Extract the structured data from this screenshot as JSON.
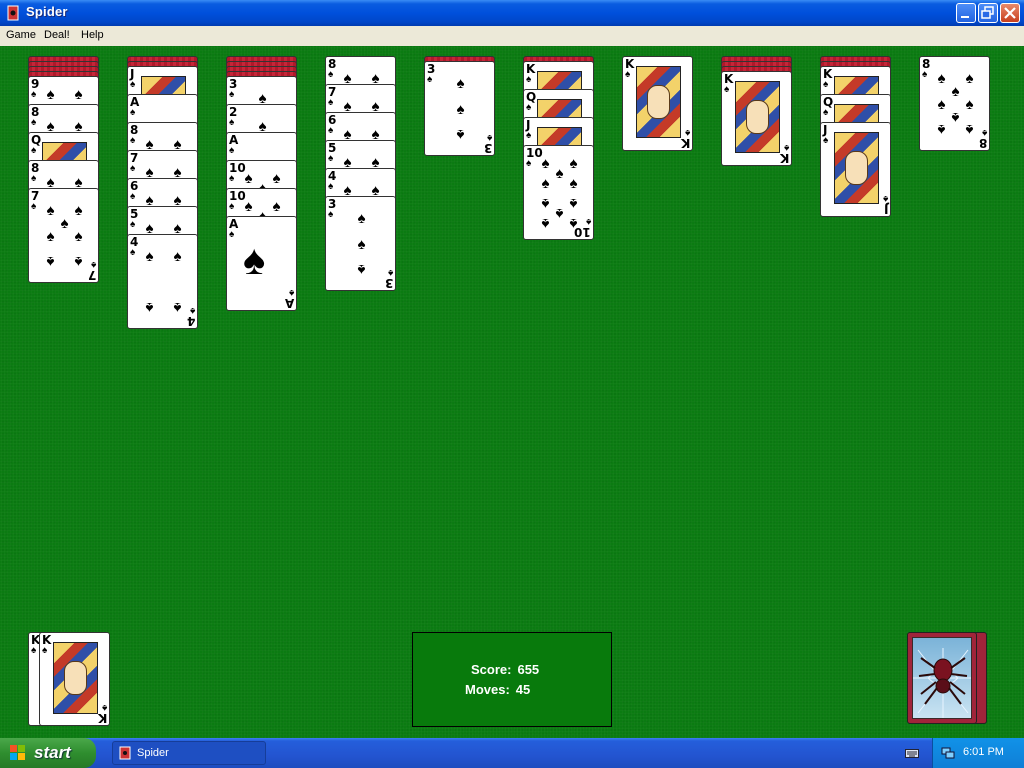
{
  "window": {
    "title": "Spider"
  },
  "menu": [
    "Game",
    "Deal!",
    "Help"
  ],
  "tableau": [
    {
      "column": 1,
      "facedown": 4,
      "cards": [
        "9♠",
        "8♠",
        "Q♠",
        "8♠",
        "7♠"
      ]
    },
    {
      "column": 2,
      "facedown": 2,
      "cards": [
        "J♠",
        "A♠",
        "8♠",
        "7♠",
        "6♠",
        "5♠",
        "4♠"
      ]
    },
    {
      "column": 3,
      "facedown": 4,
      "cards": [
        "3♠",
        "2♠",
        "A♠",
        "10♠",
        "10♠",
        "A♠"
      ]
    },
    {
      "column": 4,
      "facedown": 0,
      "cards": [
        "8♠",
        "7♠",
        "6♠",
        "5♠",
        "4♠",
        "3♠"
      ]
    },
    {
      "column": 5,
      "facedown": 1,
      "cards": [
        "3♠"
      ]
    },
    {
      "column": 6,
      "facedown": 1,
      "cards": [
        "K♠",
        "Q♠",
        "J♠",
        "10♠"
      ]
    },
    {
      "column": 7,
      "facedown": 0,
      "cards": [
        "K♠"
      ]
    },
    {
      "column": 8,
      "facedown": 3,
      "cards": [
        "K♠"
      ]
    },
    {
      "column": 9,
      "facedown": 2,
      "cards": [
        "K♠",
        "Q♠",
        "J♠"
      ]
    },
    {
      "column": 10,
      "facedown": 0,
      "cards": [
        "8♠"
      ]
    }
  ],
  "completed": {
    "top": "K♠"
  },
  "score": {
    "score_label": "Score:",
    "score_value": "655",
    "moves_label": "Moves:",
    "moves_value": "45"
  },
  "stock": {
    "piles": 2
  },
  "taskbar": {
    "start": "start",
    "task": "Spider",
    "clock": "6:01 PM"
  },
  "colors": {
    "felt": "#0b7b12",
    "card_back": "#b0182a",
    "titlebar": "#0050dc"
  }
}
